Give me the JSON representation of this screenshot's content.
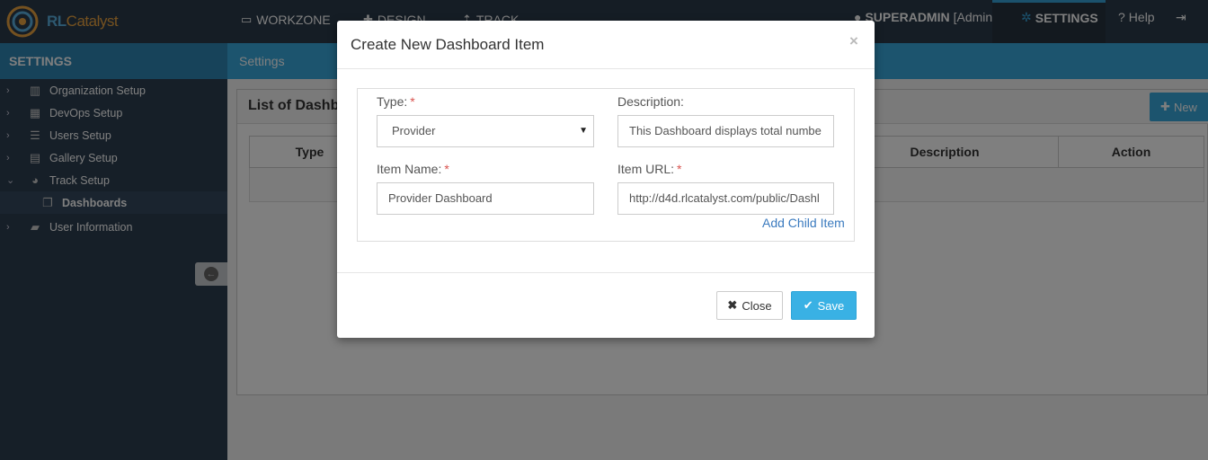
{
  "brand": {
    "logo_prefix": "RL",
    "logo_suffix": "Catalyst"
  },
  "topnav": {
    "items": [
      {
        "label": "WORKZONE",
        "icon": "monitor-icon",
        "glyph": "▭"
      },
      {
        "label": "DESIGN",
        "icon": "puzzle-icon",
        "glyph": "✚"
      },
      {
        "label": "TRACK",
        "icon": "pin-icon",
        "glyph": "⇡"
      }
    ],
    "user": {
      "name": "SUPERADMIN",
      "role": "[Admin]"
    },
    "settings_label": "SETTINGS",
    "help_label": "Help"
  },
  "subheader": {
    "section": "SETTINGS",
    "breadcrumb": "Settings"
  },
  "sidebar": {
    "items": [
      {
        "label": "Organization Setup",
        "icon": "building-icon"
      },
      {
        "label": "DevOps Setup",
        "icon": "grid-icon"
      },
      {
        "label": "Users Setup",
        "icon": "users-list-icon"
      },
      {
        "label": "Gallery Setup",
        "icon": "gallery-icon"
      },
      {
        "label": "Track Setup",
        "icon": "dashboard-icon",
        "expanded": true
      },
      {
        "label": "Dashboards",
        "icon": "copy-icon",
        "active": true
      },
      {
        "label": "User Information",
        "icon": "book-icon"
      }
    ]
  },
  "panel": {
    "title": "List of Dashboards",
    "new_button": "New",
    "columns": [
      "Type",
      "Description",
      "Action"
    ]
  },
  "modal": {
    "title": "Create New Dashboard Item",
    "close_glyph": "×",
    "type": {
      "label": "Type:",
      "required": "*",
      "value": "Provider"
    },
    "description": {
      "label": "Description:",
      "value": "This Dashboard displays total numbe"
    },
    "item_name": {
      "label": "Item Name:",
      "required": "*",
      "value": "Provider Dashboard"
    },
    "item_url": {
      "label": "Item URL:",
      "required": "*",
      "value": "http://d4d.rlcatalyst.com/public/Dashl"
    },
    "add_child_label": "Add Child Item",
    "close_button": "Close",
    "save_button": "Save"
  }
}
